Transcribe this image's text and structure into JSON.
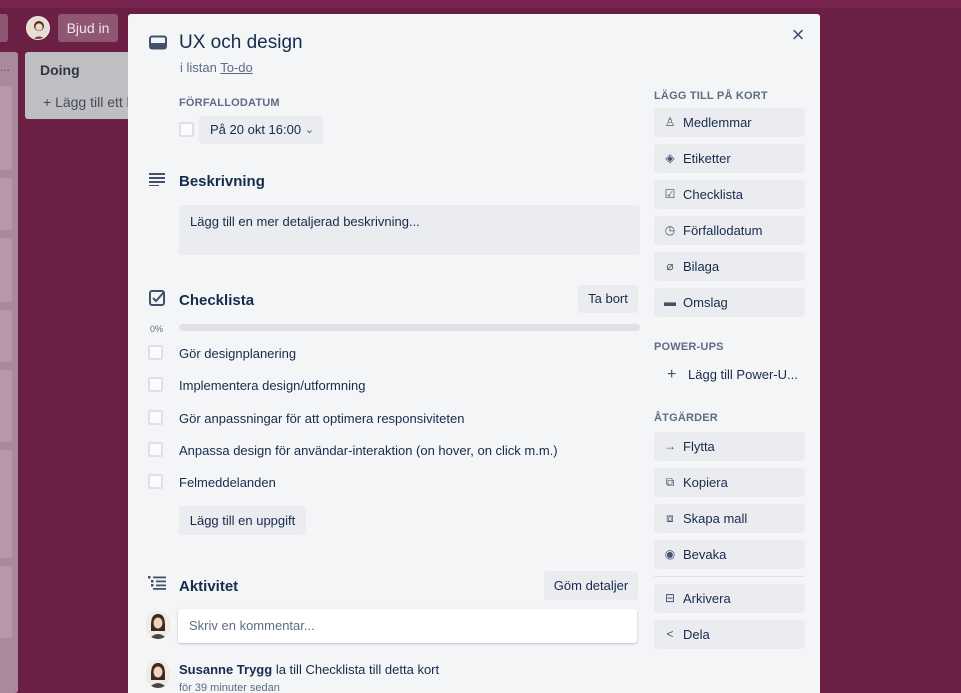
{
  "board": {
    "invite_label": "Bjud in",
    "doing_list_title": "Doing",
    "doing_add_label": "+ Lägg till ett k",
    "left_menu_dots": "..."
  },
  "card": {
    "title": "UX och design",
    "in_list_prefix": "i listan",
    "list_name": "To-do",
    "close_icon": "×",
    "due": {
      "label": "FÖRFALLODATUM",
      "value": "På 20 okt 16:00",
      "chevron": "⌄"
    },
    "description": {
      "title": "Beskrivning",
      "placeholder": "Lägg till en mer detaljerad beskrivning..."
    },
    "checklist": {
      "title": "Checklista",
      "delete_label": "Ta bort",
      "progress_pct": "0%",
      "progress_value": 0,
      "items": [
        "Gör designplanering",
        "Implementera design/utformning",
        "Gör anpassningar för att optimera responsiviteten",
        "Anpassa design för användar-interaktion (on hover, on click m.m.)",
        "Felmeddelanden"
      ],
      "add_item_label": "Lägg till en uppgift"
    },
    "activity": {
      "title": "Aktivitet",
      "toggle_label": "Göm detaljer",
      "comment_placeholder": "Skriv en kommentar...",
      "entries": [
        {
          "user": "Susanne Trygg",
          "action": "la till Checklista till detta kort",
          "time": "för 39 minuter sedan"
        }
      ]
    }
  },
  "sidebar": {
    "add_heading": "LÄGG TILL PÅ KORT",
    "add_items": [
      {
        "label": "Medlemmar",
        "icon": "♙"
      },
      {
        "label": "Etiketter",
        "icon": "◈"
      },
      {
        "label": "Checklista",
        "icon": "☑"
      },
      {
        "label": "Förfallodatum",
        "icon": "◷"
      },
      {
        "label": "Bilaga",
        "icon": "⌀"
      },
      {
        "label": "Omslag",
        "icon": "▬"
      }
    ],
    "powerups_heading": "POWER-UPS",
    "powerup_add": {
      "label": "Lägg till Power-U...",
      "icon": "+"
    },
    "actions_heading": "ÅTGÄRDER",
    "actions": [
      {
        "label": "Flytta",
        "icon": "→"
      },
      {
        "label": "Kopiera",
        "icon": "⧉"
      },
      {
        "label": "Skapa mall",
        "icon": "⧈"
      },
      {
        "label": "Bevaka",
        "icon": "◉"
      }
    ],
    "actions_secondary": [
      {
        "label": "Arkivera",
        "icon": "⊟"
      },
      {
        "label": "Dela",
        "icon": "<"
      }
    ]
  }
}
